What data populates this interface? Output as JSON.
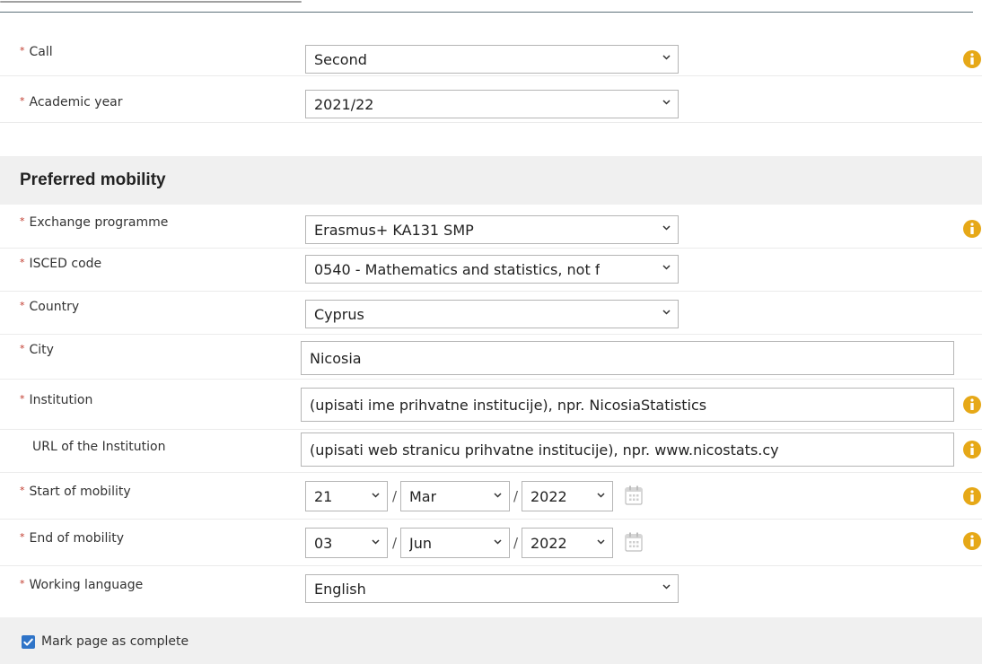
{
  "general": {
    "call": {
      "label": "Call",
      "value": "Second"
    },
    "academic_year": {
      "label": "Academic year",
      "value": "2021/22"
    }
  },
  "preferred_mobility": {
    "title": "Preferred mobility",
    "exchange_programme": {
      "label": "Exchange programme",
      "value": "Erasmus+ KA131 SMP"
    },
    "isced_code": {
      "label": "ISCED code",
      "value": "0540 - Mathematics and statistics, not f"
    },
    "country": {
      "label": "Country",
      "value": "Cyprus"
    },
    "city": {
      "label": "City",
      "value": "Nicosia"
    },
    "institution": {
      "label": "Institution",
      "value": "(upisati ime prihvatne institucije), npr. NicosiaStatistics"
    },
    "url_institution": {
      "label": "URL of the Institution",
      "value": "(upisati web stranicu prihvatne institucije), npr. www.nicostats.cy"
    },
    "start_mobility": {
      "label": "Start of mobility",
      "day": "21",
      "month": "Mar",
      "year": "2022"
    },
    "end_mobility": {
      "label": "End of mobility",
      "day": "03",
      "month": "Jun",
      "year": "2022"
    },
    "working_language": {
      "label": "Working language",
      "value": "English"
    }
  },
  "footer": {
    "mark_complete_label": "Mark page as complete",
    "mark_complete_checked": true
  },
  "required_marker": "*",
  "date_separator": "/",
  "colors": {
    "accent": "#2f74c8",
    "info": "#e6a817",
    "required": "#c0392b"
  },
  "icons": {
    "info": "info-icon",
    "calendar": "calendar-icon",
    "dropdown": "chevron-down-icon",
    "check": "checkmark-icon"
  }
}
